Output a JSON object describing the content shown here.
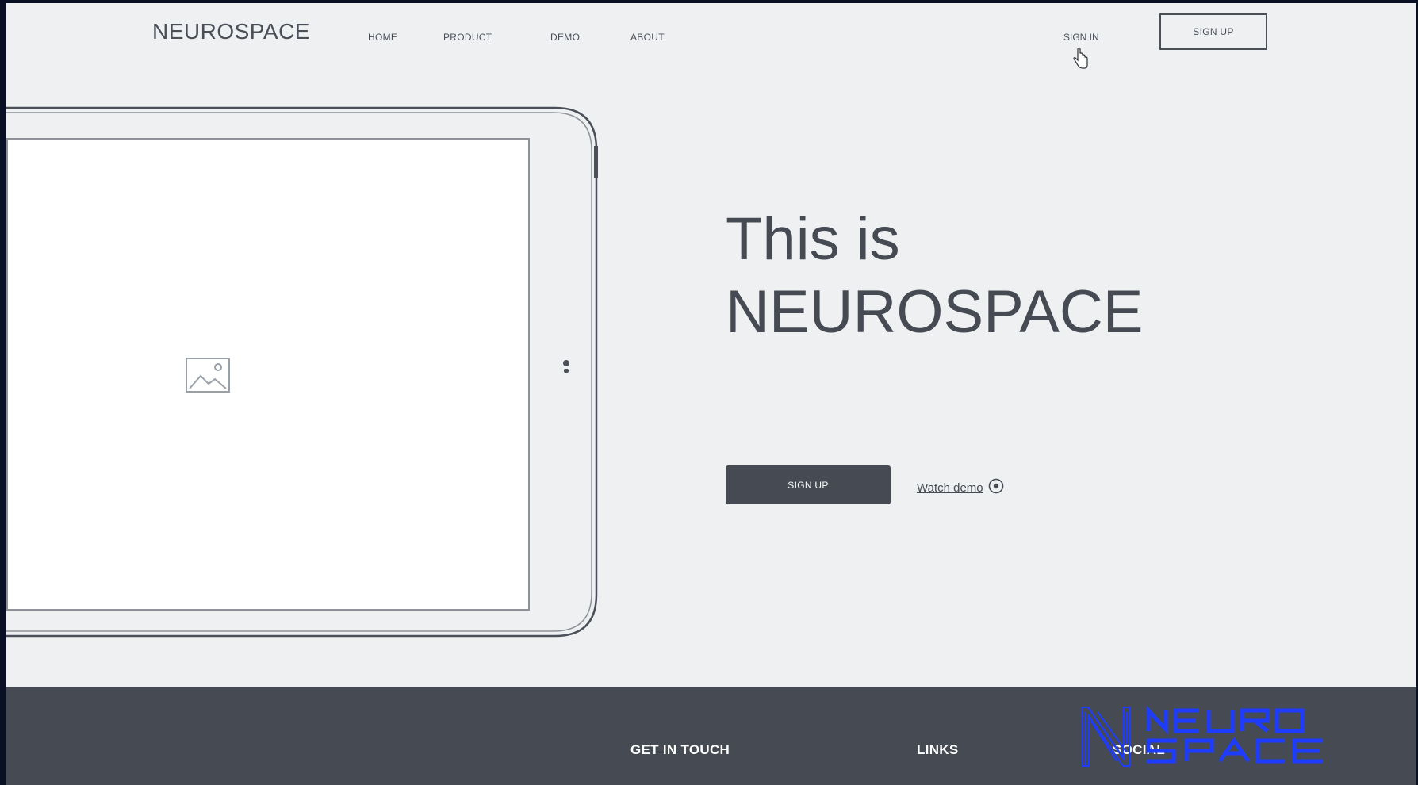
{
  "nav": {
    "logo": "NEUROSPACE",
    "links": [
      "HOME",
      "PRODUCT",
      "DEMO",
      "ABOUT"
    ],
    "sign_in": "SIGN IN",
    "sign_up": "SIGN UP"
  },
  "hero": {
    "line1": "This is",
    "line2": "NEUROSPACE",
    "signup_label": "SIGN UP",
    "watch_demo_label": "Watch demo"
  },
  "footer": {
    "columns": [
      "GET IN TOUCH",
      "LINKS",
      "SOCIAL"
    ]
  },
  "brand_mark": {
    "text": "NEURO SPACE",
    "color": "#1e3cff"
  },
  "colors": {
    "page_bg": "#eef0f2",
    "dark": "#454a53",
    "outer_bg": "#0a1024"
  },
  "icons": [
    "pointer-hand-icon",
    "image-placeholder-icon",
    "play-circle-icon"
  ]
}
